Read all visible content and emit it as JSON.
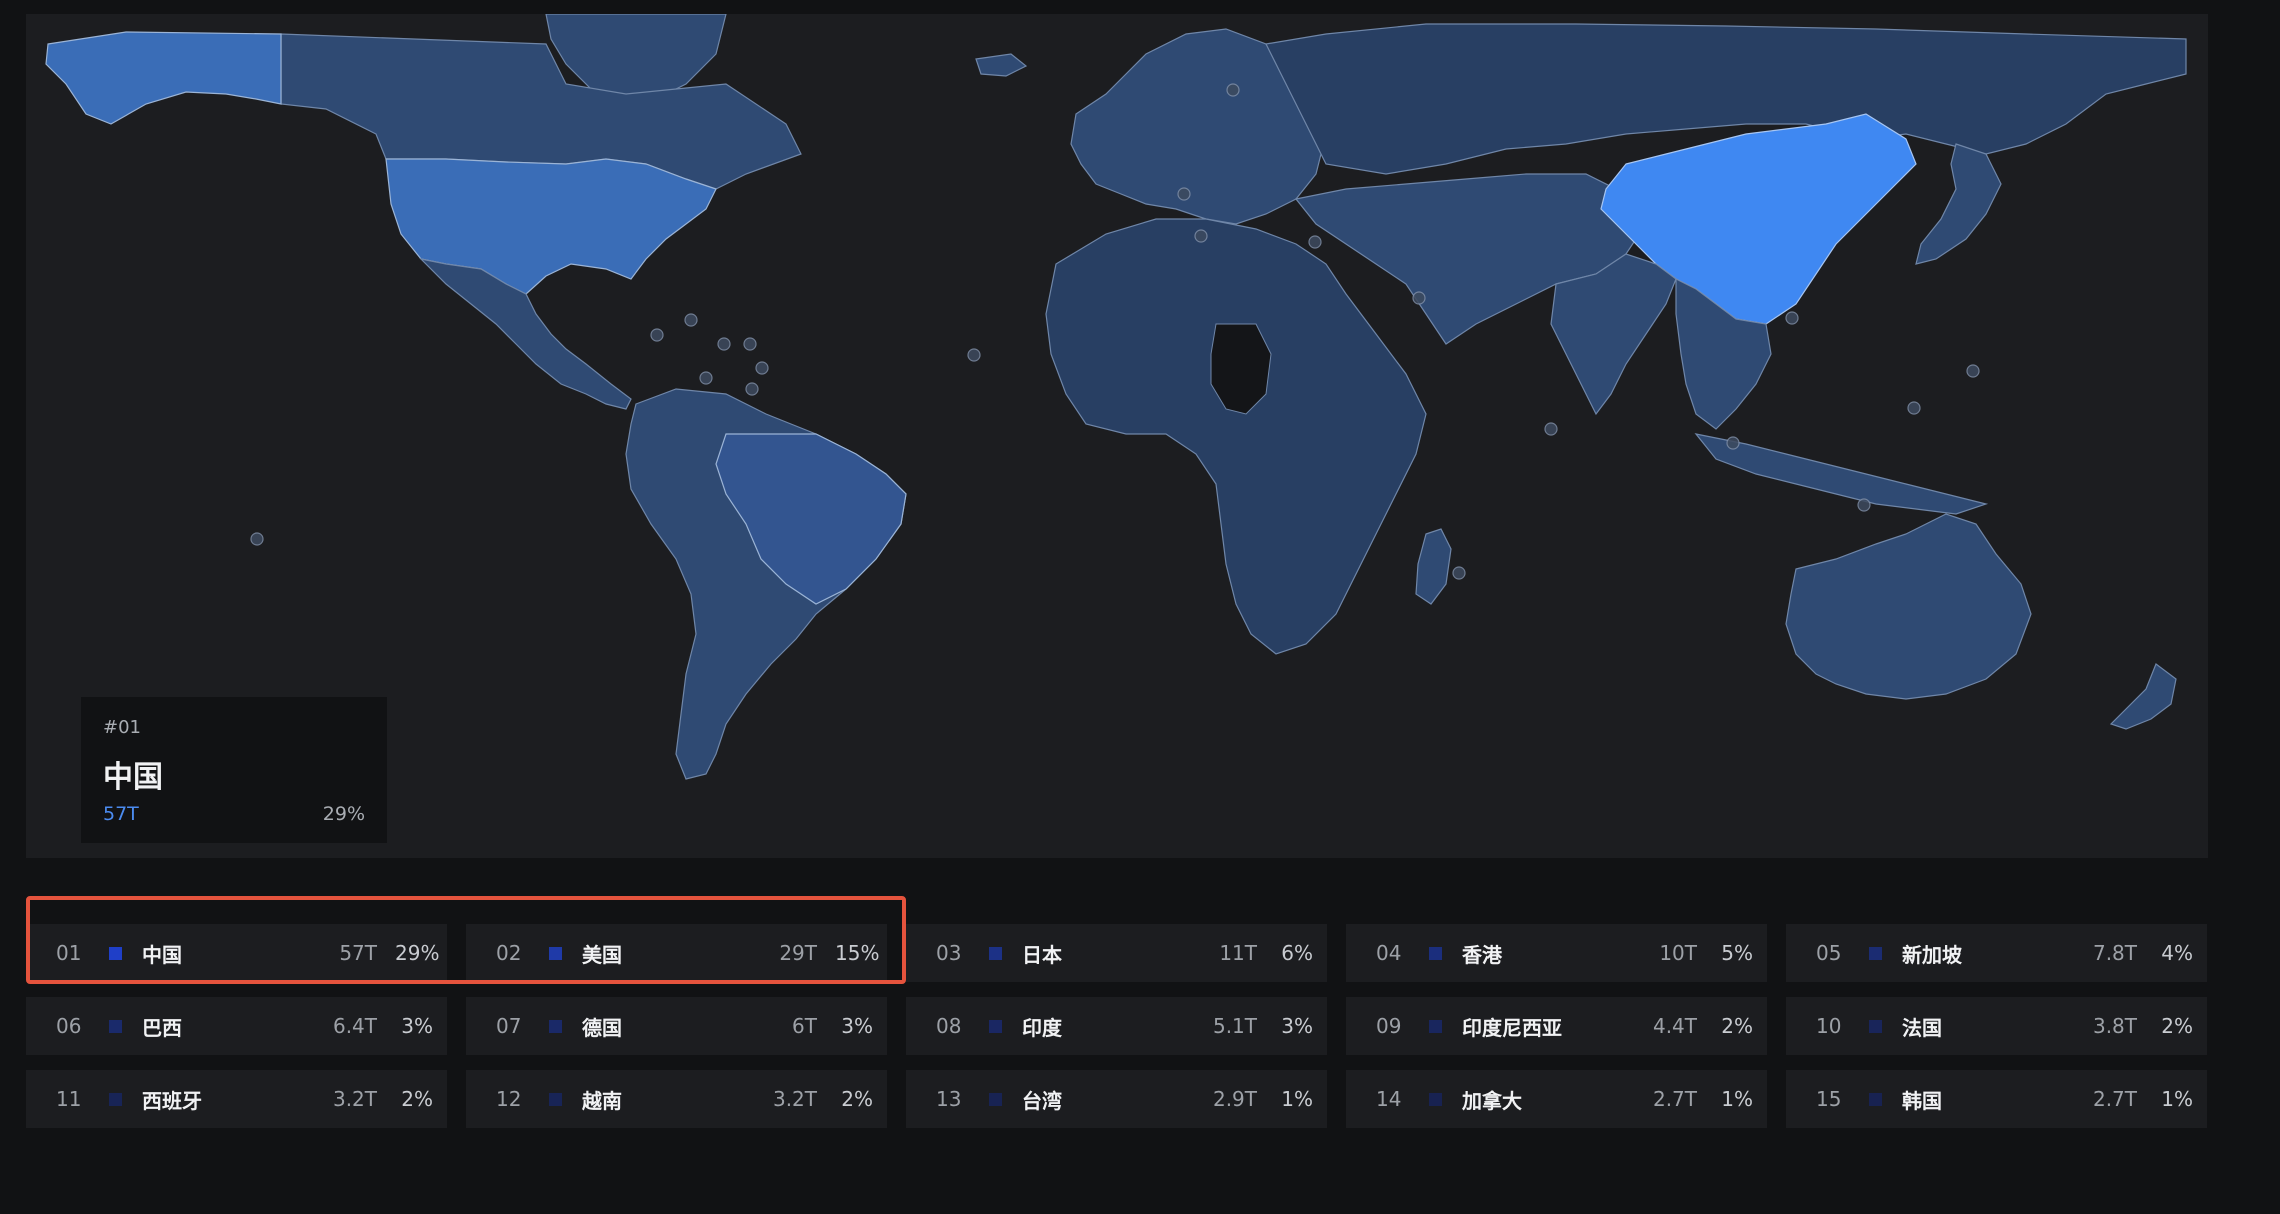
{
  "tooltip": {
    "rank": "#01",
    "name": "中国",
    "value": "57T",
    "percent": "29%"
  },
  "rankings": [
    {
      "num": "01",
      "name": "中国",
      "value": "57T",
      "percent": "29%",
      "color": "#1f3fc8"
    },
    {
      "num": "02",
      "name": "美国",
      "value": "29T",
      "percent": "15%",
      "color": "#1f3aa8"
    },
    {
      "num": "03",
      "name": "日本",
      "value": "11T",
      "percent": "6%",
      "color": "#1c3186"
    },
    {
      "num": "04",
      "name": "香港",
      "value": "10T",
      "percent": "5%",
      "color": "#1b2e7d"
    },
    {
      "num": "05",
      "name": "新加坡",
      "value": "7.8T",
      "percent": "4%",
      "color": "#1b2c72"
    },
    {
      "num": "06",
      "name": "巴西",
      "value": "6.4T",
      "percent": "3%",
      "color": "#1a2a6b"
    },
    {
      "num": "07",
      "name": "德国",
      "value": "6T",
      "percent": "3%",
      "color": "#1a2968"
    },
    {
      "num": "08",
      "name": "印度",
      "value": "5.1T",
      "percent": "3%",
      "color": "#1a2763"
    },
    {
      "num": "09",
      "name": "印度尼西亚",
      "value": "4.4T",
      "percent": "2%",
      "color": "#19265e"
    },
    {
      "num": "10",
      "name": "法国",
      "value": "3.8T",
      "percent": "2%",
      "color": "#19255a"
    },
    {
      "num": "11",
      "name": "西班牙",
      "value": "3.2T",
      "percent": "2%",
      "color": "#182456"
    },
    {
      "num": "12",
      "name": "越南",
      "value": "3.2T",
      "percent": "2%",
      "color": "#182456"
    },
    {
      "num": "13",
      "name": "台湾",
      "value": "2.9T",
      "percent": "1%",
      "color": "#182353"
    },
    {
      "num": "14",
      "name": "加拿大",
      "value": "2.7T",
      "percent": "1%",
      "color": "#182251"
    },
    {
      "num": "15",
      "name": "韩国",
      "value": "2.7T",
      "percent": "1%",
      "color": "#182251"
    }
  ],
  "colors": {
    "highlight": "#e5533d",
    "top_country": "#3f88f2",
    "land": "#2f4a73"
  }
}
